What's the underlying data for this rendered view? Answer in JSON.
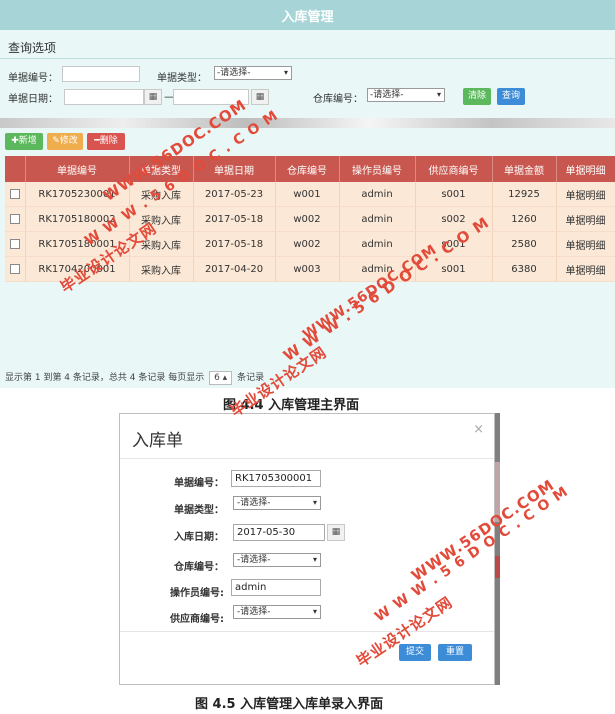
{
  "screen1": {
    "title": "入库管理",
    "query_title": "查询选项",
    "filters": {
      "doc_no_label": "单据编号：",
      "doc_type_label": "单据类型：",
      "doc_type_value": "-请选择-",
      "doc_date_label": "单据日期：",
      "date_sep": "—",
      "warehouse_label": "仓库编号：",
      "warehouse_value": "-请选择-",
      "clear_label": "清除",
      "search_label": "查询"
    },
    "toolbar": {
      "add_label": "✚新增",
      "edit_label": "✎修改",
      "delete_label": "━删除"
    },
    "table": {
      "headers": [
        "单据编号",
        "单据类型",
        "单据日期",
        "仓库编号",
        "操作员编号",
        "供应商编号",
        "单据金额",
        "单据明细"
      ],
      "rows": [
        [
          "RK1705230001",
          "采购入库",
          "2017-05-23",
          "w001",
          "admin",
          "s001",
          "12925",
          "单据明细"
        ],
        [
          "RK1705180002",
          "采购入库",
          "2017-05-18",
          "w002",
          "admin",
          "s002",
          "1260",
          "单据明细"
        ],
        [
          "RK1705180001",
          "采购入库",
          "2017-05-18",
          "w002",
          "admin",
          "s001",
          "2580",
          "单据明细"
        ],
        [
          "RK1704200001",
          "采购入库",
          "2017-04-20",
          "w003",
          "admin",
          "s001",
          "6380",
          "单据明细"
        ]
      ]
    },
    "pager": {
      "text_before": "显示第 1 到第 4 条记录，总共 4 条记录 每页显示",
      "page_size": "6 ▴",
      "text_after": "条记录"
    }
  },
  "caption1": "图 4.4  入库管理主界面",
  "modal": {
    "title": "入库单",
    "close": "×",
    "fields": {
      "doc_no_label": "单据编号：",
      "doc_no_value": "RK1705300001",
      "doc_type_label": "单据类型：",
      "doc_type_value": "-请选择-",
      "in_date_label": "入库日期：",
      "in_date_value": "2017-05-30",
      "warehouse_label": "仓库编号：",
      "warehouse_value": "-请选择-",
      "operator_label": "操作员编号:",
      "operator_value": "admin",
      "supplier_label": "供应商编号:",
      "supplier_value": "-请选择-"
    },
    "submit_label": "提交",
    "reset_label": "重置"
  },
  "caption2": "图 4.5  入库管理入库单录入界面",
  "watermarks": {
    "site": "WWW.56DOC.COM",
    "site_dotted": "W W W . 5 6 D O C . C O M",
    "brand": "毕业设计论文网"
  }
}
